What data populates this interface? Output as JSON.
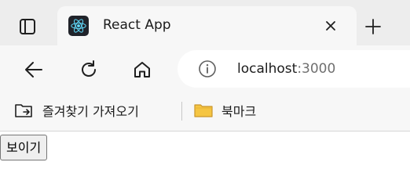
{
  "browser": {
    "tab": {
      "title": "React App"
    },
    "address": {
      "host": "localhost",
      "port": ":3000"
    },
    "bookmarks": [
      {
        "label": "즐겨찾기 가져오기",
        "icon": "folder-import-icon"
      },
      {
        "label": "북마크",
        "icon": "folder-icon"
      }
    ]
  },
  "page": {
    "button_label": "보이기"
  },
  "colors": {
    "tabstrip": "#ededed",
    "toolbar": "#f7f7f7",
    "react_logo": "#61dafb",
    "folder": "#f5c542"
  }
}
